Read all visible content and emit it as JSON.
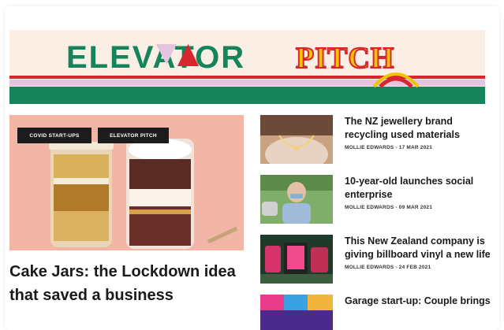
{
  "banner": {
    "logo_left": "ELEVATOR",
    "logo_right": "PITCH",
    "colors": {
      "cream": "#fbeee4",
      "green": "#16845b",
      "red": "#d8262e",
      "yellow": "#f2c500",
      "pink": "#e6c3df"
    }
  },
  "feature": {
    "tags": [
      "COVID START-UPS",
      "ELEVATOR PITCH"
    ],
    "title": "Cake Jars: the Lockdown idea that saved a business"
  },
  "articles": [
    {
      "title": "The NZ jewellery brand recycling used materials",
      "meta": "MOLLIE EDWARDS - 17 MAR 2021"
    },
    {
      "title": "10-year-old launches social enterprise",
      "meta": "MOLLIE EDWARDS - 09 MAR 2021"
    },
    {
      "title": "This New Zealand company is giving billboard vinyl a new life",
      "meta": "MOLLIE EDWARDS - 24 FEB 2021"
    },
    {
      "title": "Garage start-up: Couple brings",
      "meta": ""
    }
  ]
}
